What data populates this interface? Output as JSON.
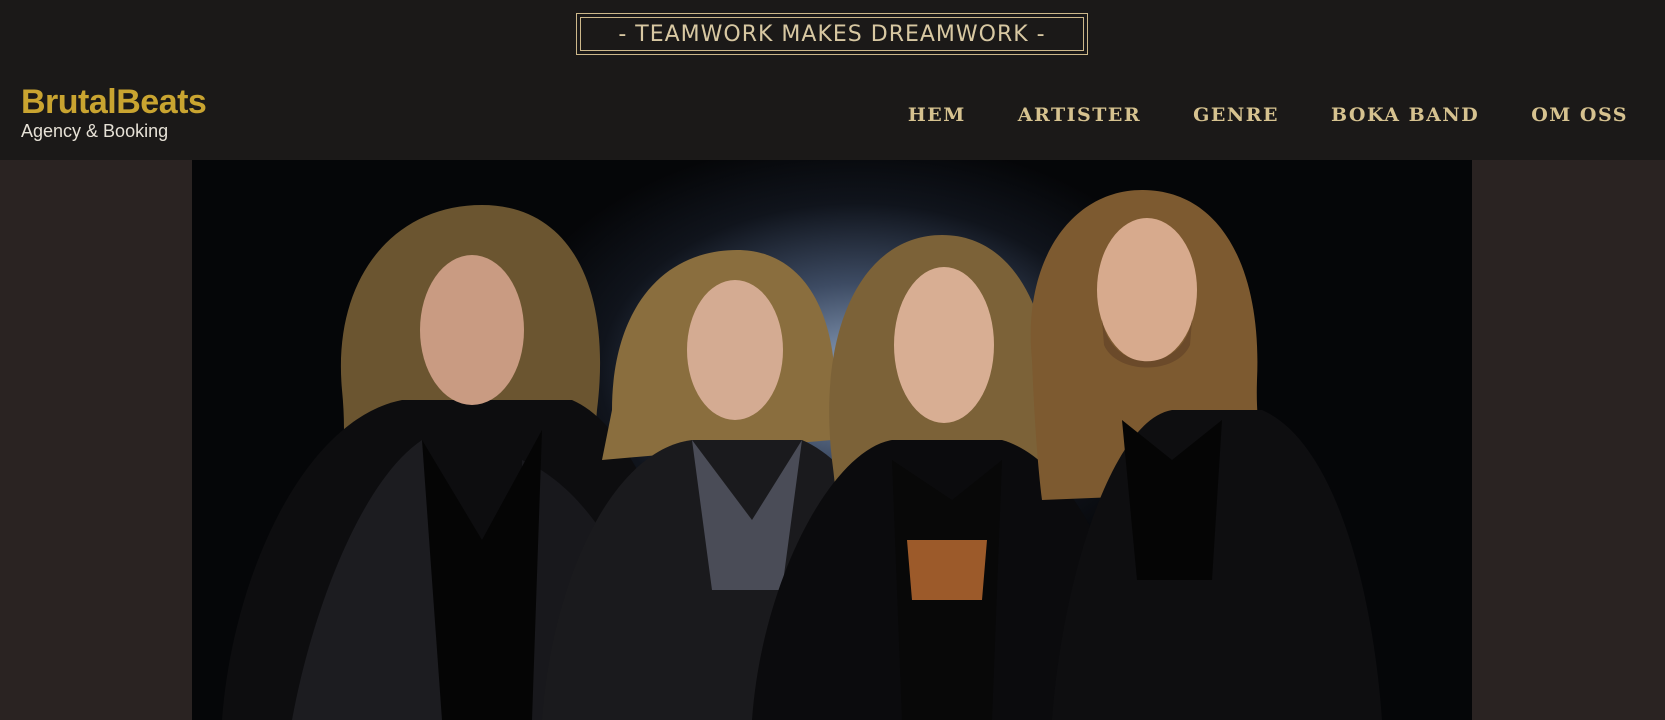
{
  "tagline": "- TEAMWORK MAKES DREAMWORK -",
  "logo": {
    "name": "BrutalBeats",
    "subtitle": "Agency & Booking"
  },
  "nav": {
    "items": [
      {
        "label": "HEM"
      },
      {
        "label": "ARTISTER"
      },
      {
        "label": "GENRE"
      },
      {
        "label": "BOKA BAND"
      },
      {
        "label": "OM OSS"
      }
    ]
  },
  "hero": {
    "image": "band-photo"
  },
  "colors": {
    "header_bg": "#1b1918",
    "page_bg": "#2a2322",
    "accent_gold": "#c9a430",
    "nav_text": "#d6c28f",
    "tagline_border": "#cdb88a"
  }
}
